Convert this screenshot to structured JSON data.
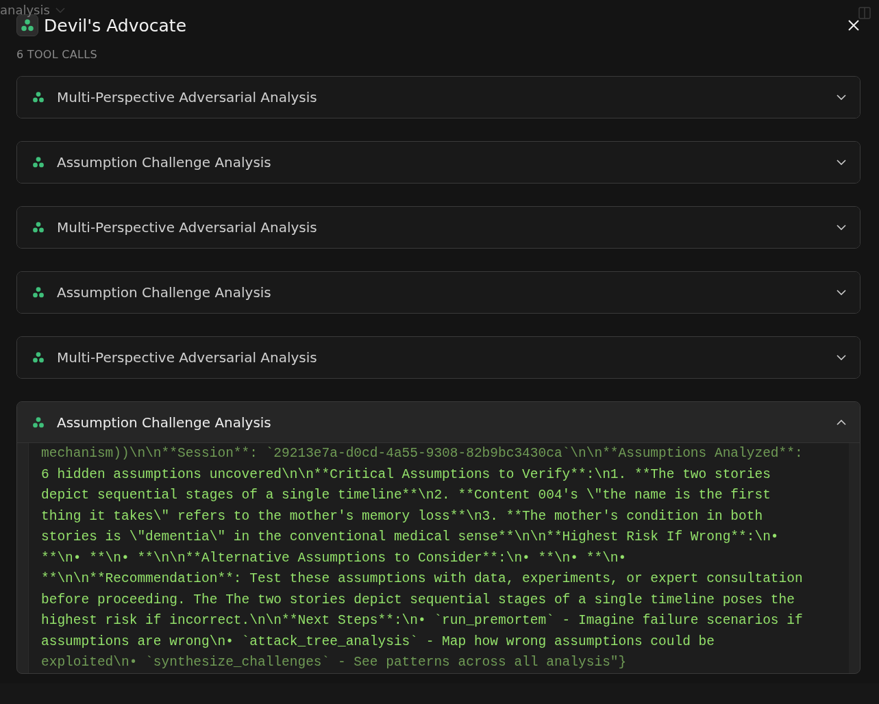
{
  "background": {
    "breadcrumb": "analysis"
  },
  "dialog": {
    "title": "Devil's Advocate",
    "subtitle": "6 TOOL CALLS"
  },
  "tool_calls": [
    {
      "title": "Multi-Perspective Adversarial Analysis",
      "expanded": false
    },
    {
      "title": "Assumption Challenge Analysis",
      "expanded": false
    },
    {
      "title": "Multi-Perspective Adversarial Analysis",
      "expanded": false
    },
    {
      "title": "Assumption Challenge Analysis",
      "expanded": false
    },
    {
      "title": "Multi-Perspective Adversarial Analysis",
      "expanded": false
    },
    {
      "title": "Assumption Challenge Analysis",
      "expanded": true,
      "output_lines": [
        "mechanism))\\n\\n**Session**: `29213e7a-d0cd-4a55-9308-82b9bc3430ca`\\n\\n**Assumptions Analyzed**:",
        "6 hidden assumptions uncovered\\n\\n**Critical Assumptions to Verify**:\\n1. **The two stories",
        "depict sequential stages of a single timeline**\\n2. **Content 004's \\\"the name is the first",
        "thing it takes\\\" refers to the mother's memory loss**\\n3. **The mother's condition in both",
        "stories is \\\"dementia\\\" in the conventional medical sense**\\n\\n**Highest Risk If Wrong**:\\n•",
        "**\\n• **\\n• **\\n\\n**Alternative Assumptions to Consider**:\\n• **\\n• **\\n•",
        "**\\n\\n**Recommendation**: Test these assumptions with data, experiments, or expert consultation",
        "before proceeding. The The two stories depict sequential stages of a single timeline poses the",
        "highest risk if incorrect.\\n\\n**Next Steps**:\\n• `run_premortem` - Imagine failure scenarios if",
        "assumptions are wrong\\n• `attack_tree_analysis` - Map how wrong assumptions could be",
        "exploited\\n• `synthesize_challenges` - See patterns across all analysis\"}"
      ]
    }
  ]
}
